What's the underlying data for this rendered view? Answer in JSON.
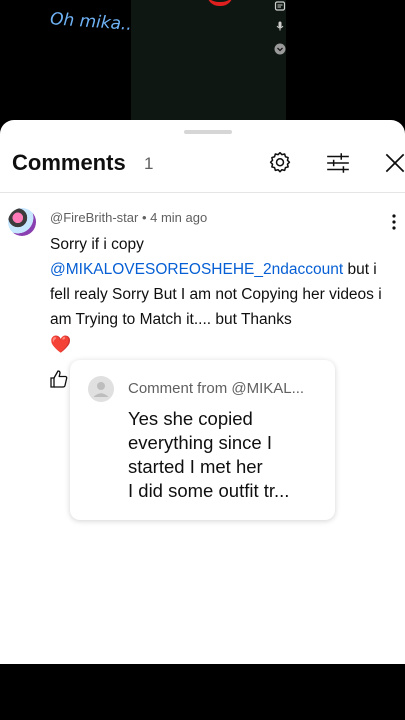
{
  "video": {
    "overlay_text": "Oh mika..",
    "icons": [
      "caption-icon",
      "mic-icon",
      "chevron-down-icon"
    ]
  },
  "comments_panel": {
    "title": "Comments",
    "count": "1",
    "header_icons": [
      "settings-icon",
      "filter-icon",
      "close-icon"
    ]
  },
  "comment": {
    "author": "@FireBrith-star",
    "separator": " • ",
    "time": "4 min ago",
    "text_before": "Sorry if i copy ",
    "mention": "@MIKALOVESOREOSHEHE_2ndaccount",
    "text_after": " but i fell realy Sorry But I am not Copying her videos i am Trying to Match it.... but Thanks",
    "emoji": "❤️"
  },
  "reply_card": {
    "from_label": "Comment from @MIKAL...",
    "lines": [
      "Yes she copied",
      "everything since I",
      "started I met her",
      "I did some outfit tr..."
    ]
  },
  "colors": {
    "mention": "#065fd4",
    "overlay_text": "#6fb2f5",
    "heart": "#e0245e"
  }
}
